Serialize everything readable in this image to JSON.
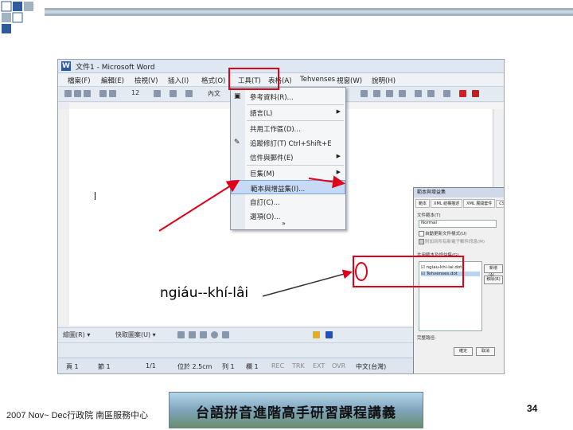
{
  "window": {
    "title": "文件1 - Microsoft Word"
  },
  "menubar": [
    "檔案(F)",
    "編輯(E)",
    "檢視(V)",
    "插入(I)",
    "格式(O)",
    "工具(T)",
    "表格(A)",
    "Tehvenses",
    "視窗(W)",
    "說明(H)"
  ],
  "toolbar": {
    "font_size": "12",
    "style_box": "內文"
  },
  "tools_menu": {
    "items": [
      {
        "label": "參考資料(R)...",
        "submenu": false
      },
      {
        "label": "語言(L)",
        "submenu": true
      },
      {
        "label": "共用工作區(D)...",
        "submenu": false
      },
      {
        "label": "追蹤修訂(T)   Ctrl+Shift+E",
        "submenu": false
      },
      {
        "label": "信件與郵件(E)",
        "submenu": true
      },
      {
        "label": "巨集(M)",
        "submenu": true
      },
      {
        "label": "範本與增益集(I)...",
        "submenu": false,
        "highlighted": true
      },
      {
        "label": "自訂(C)...",
        "submenu": false
      },
      {
        "label": "選項(O)...",
        "submenu": false
      }
    ],
    "more": "»"
  },
  "dialog": {
    "title": "範本與增益集",
    "tabs": [
      "範本",
      "XML 結構描述",
      "XML 展開套件",
      "CSS"
    ],
    "template_label": "文件範本(T)",
    "template_value": "Normal",
    "auto_update": "自動更新文件樣式(U)",
    "attach_all": "附加到所有新電子郵件訊息(M)",
    "global_label": "共用範本及增益集(G)",
    "list_items": [
      "ngiau-khi-lai.dot",
      "Tehvenses.dot"
    ],
    "buttons": [
      "新增(A)...",
      "移除(R)"
    ],
    "path_label": "完整路徑:",
    "ok": "確定",
    "cancel": "取消"
  },
  "statusbar": [
    "頁 1",
    "節 1",
    "1/1",
    "位於 2.5cm",
    "列 1",
    "欄 1",
    "REC",
    "TRK",
    "EXT",
    "OVR",
    "中文(台灣)"
  ],
  "drawbar": {
    "draw_label": "繪圖(R) ▾",
    "autoshapes": "快取圖案(U) ▾"
  },
  "annotation": "ngiáu--khí-lâi",
  "footer": {
    "left": "2007 Nov~ Dec行政院 南區服務中心",
    "banner": "台語拼音進階高手研習課程講義",
    "page_number": "34"
  },
  "colors": {
    "annotation_red": "#e0001a",
    "corner_blue": "#2f5d9c"
  }
}
